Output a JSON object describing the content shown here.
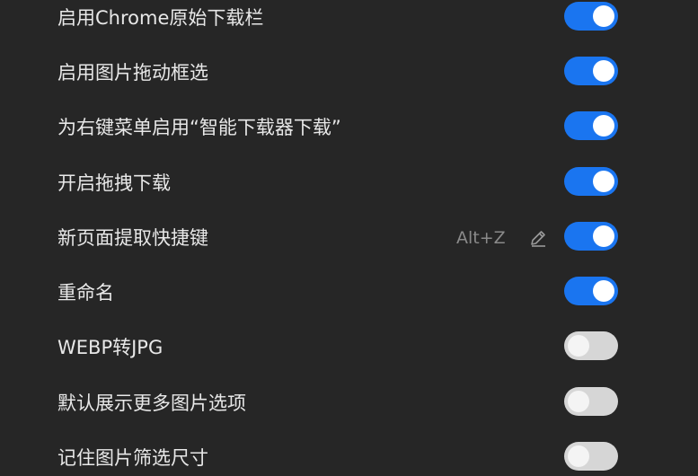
{
  "settings": [
    {
      "label": "启用Chrome原始下载栏",
      "enabled": true
    },
    {
      "label": "启用图片拖动框选",
      "enabled": true
    },
    {
      "label": "为右键菜单启用“智能下载器下载”",
      "enabled": true
    },
    {
      "label": "开启拖拽下载",
      "enabled": true
    },
    {
      "label": "新页面提取快捷键",
      "enabled": true,
      "shortcut": "Alt+Z",
      "shortcut_icon": "pencil-edit-icon"
    },
    {
      "label": "重命名",
      "enabled": true
    },
    {
      "label": "WEBP转JPG",
      "enabled": false
    },
    {
      "label": "默认展示更多图片选项",
      "enabled": false
    },
    {
      "label": "记住图片筛选尺寸",
      "enabled": false
    }
  ],
  "colors": {
    "background": "#262626",
    "toggle_on": "#1a75f0",
    "toggle_off": "#d6d6d6",
    "label_text": "#e8e8e8",
    "shortcut_text": "#8a8a8a"
  }
}
